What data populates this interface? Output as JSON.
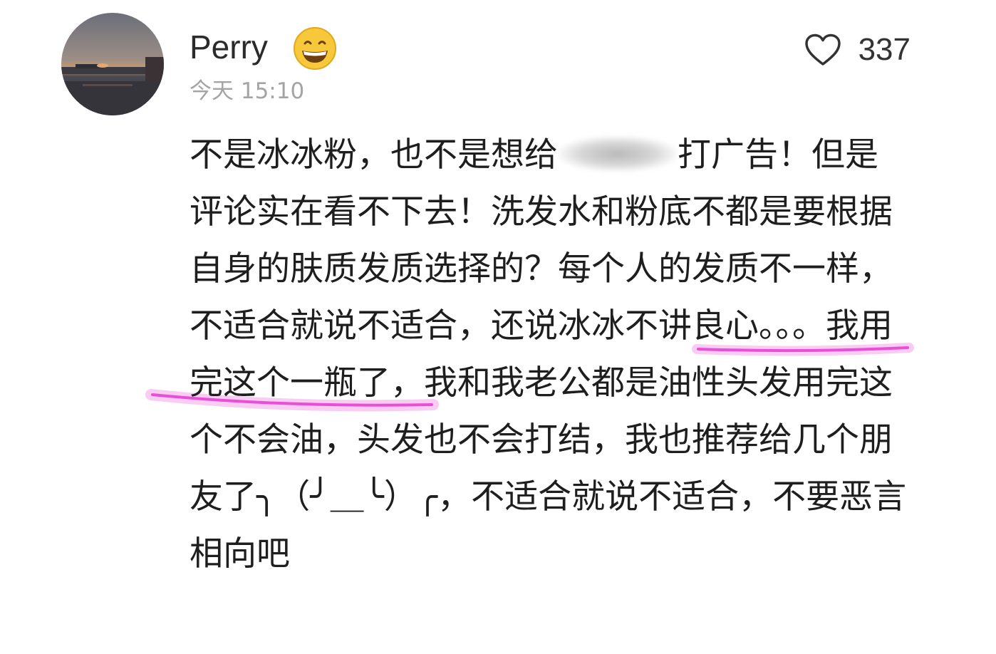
{
  "comment_card": {
    "username": "Perry",
    "timestamp": "今天 15:10",
    "like_count": "337",
    "emoji": "grinning-face",
    "comment_parts": {
      "before_redacted": "不是冰冰粉，也不是想给",
      "after_redacted": "打广告！但是评论实在看不下去！洗发水和粉底不都是要根据自身的肤质发质选择的？每个人的发质不一样，不适合就说不适合，",
      "highlighted": "还说冰冰不讲良心。。。",
      "rest": "我用完这个一瓶了，我和我老公都是油性头发用完这个不会油，头发也不会打结，我也推荐给几个朋友了╮（╯＿╰）╭，不适合就说不适合，不要恶言相向吧"
    },
    "highlight_color": "#e94fd6"
  }
}
